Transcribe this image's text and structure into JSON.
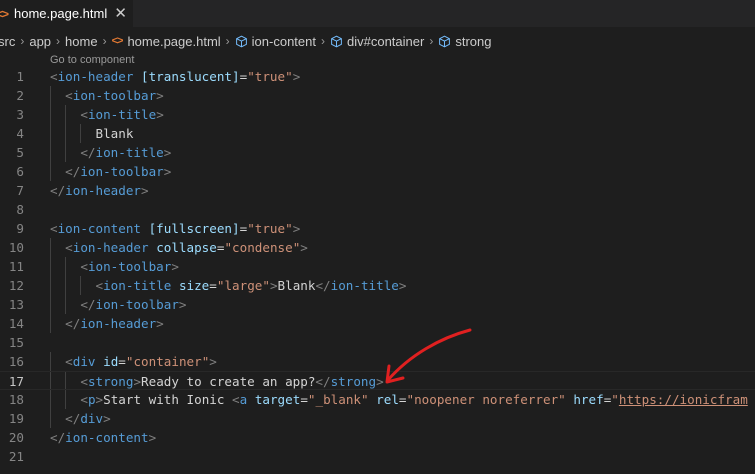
{
  "tab": {
    "icon": "html-file-icon",
    "icon_glyph": "<>",
    "title": "home.page.html",
    "close_glyph": "✕"
  },
  "breadcrumb": {
    "items": [
      {
        "label": "src"
      },
      {
        "label": "app"
      },
      {
        "label": "home"
      },
      {
        "label": "home.page.html",
        "icon": "html-file-icon",
        "icon_glyph": "<>"
      },
      {
        "label": "ion-content",
        "icon": "element-cube-icon"
      },
      {
        "label": "div#container",
        "icon": "element-cube-icon"
      },
      {
        "label": "strong",
        "icon": "element-cube-icon"
      }
    ],
    "separator": "›"
  },
  "codelens": "Go to component",
  "active_line": 17,
  "lines": [
    {
      "n": "1",
      "tokens": [
        [
          "p",
          "<"
        ],
        [
          "t",
          "ion-header"
        ],
        [
          "x",
          " "
        ],
        [
          "a",
          "[translucent]"
        ],
        [
          "x",
          "="
        ],
        [
          "s",
          "\"true\""
        ],
        [
          "p",
          ">"
        ]
      ]
    },
    {
      "n": "2",
      "tokens": [
        [
          "x",
          "  "
        ],
        [
          "p",
          "<"
        ],
        [
          "t",
          "ion-toolbar"
        ],
        [
          "p",
          ">"
        ]
      ]
    },
    {
      "n": "3",
      "tokens": [
        [
          "x",
          "    "
        ],
        [
          "p",
          "<"
        ],
        [
          "t",
          "ion-title"
        ],
        [
          "p",
          ">"
        ]
      ]
    },
    {
      "n": "4",
      "tokens": [
        [
          "x",
          "      Blank"
        ]
      ]
    },
    {
      "n": "5",
      "tokens": [
        [
          "x",
          "    "
        ],
        [
          "p",
          "</"
        ],
        [
          "t",
          "ion-title"
        ],
        [
          "p",
          ">"
        ]
      ]
    },
    {
      "n": "6",
      "tokens": [
        [
          "x",
          "  "
        ],
        [
          "p",
          "</"
        ],
        [
          "t",
          "ion-toolbar"
        ],
        [
          "p",
          ">"
        ]
      ]
    },
    {
      "n": "7",
      "tokens": [
        [
          "p",
          "</"
        ],
        [
          "t",
          "ion-header"
        ],
        [
          "p",
          ">"
        ]
      ]
    },
    {
      "n": "8",
      "tokens": []
    },
    {
      "n": "9",
      "tokens": [
        [
          "p",
          "<"
        ],
        [
          "t",
          "ion-content"
        ],
        [
          "x",
          " "
        ],
        [
          "a",
          "[fullscreen]"
        ],
        [
          "x",
          "="
        ],
        [
          "s",
          "\"true\""
        ],
        [
          "p",
          ">"
        ]
      ]
    },
    {
      "n": "10",
      "tokens": [
        [
          "x",
          "  "
        ],
        [
          "p",
          "<"
        ],
        [
          "t",
          "ion-header"
        ],
        [
          "x",
          " "
        ],
        [
          "a",
          "collapse"
        ],
        [
          "x",
          "="
        ],
        [
          "s",
          "\"condense\""
        ],
        [
          "p",
          ">"
        ]
      ]
    },
    {
      "n": "11",
      "tokens": [
        [
          "x",
          "    "
        ],
        [
          "p",
          "<"
        ],
        [
          "t",
          "ion-toolbar"
        ],
        [
          "p",
          ">"
        ]
      ]
    },
    {
      "n": "12",
      "tokens": [
        [
          "x",
          "      "
        ],
        [
          "p",
          "<"
        ],
        [
          "t",
          "ion-title"
        ],
        [
          "x",
          " "
        ],
        [
          "a",
          "size"
        ],
        [
          "x",
          "="
        ],
        [
          "s",
          "\"large\""
        ],
        [
          "p",
          ">"
        ],
        [
          "x",
          "Blank"
        ],
        [
          "p",
          "</"
        ],
        [
          "t",
          "ion-title"
        ],
        [
          "p",
          ">"
        ]
      ]
    },
    {
      "n": "13",
      "tokens": [
        [
          "x",
          "    "
        ],
        [
          "p",
          "</"
        ],
        [
          "t",
          "ion-toolbar"
        ],
        [
          "p",
          ">"
        ]
      ]
    },
    {
      "n": "14",
      "tokens": [
        [
          "x",
          "  "
        ],
        [
          "p",
          "</"
        ],
        [
          "t",
          "ion-header"
        ],
        [
          "p",
          ">"
        ]
      ]
    },
    {
      "n": "15",
      "tokens": []
    },
    {
      "n": "16",
      "tokens": [
        [
          "x",
          "  "
        ],
        [
          "p",
          "<"
        ],
        [
          "t",
          "div"
        ],
        [
          "x",
          " "
        ],
        [
          "a",
          "id"
        ],
        [
          "x",
          "="
        ],
        [
          "s",
          "\"container\""
        ],
        [
          "p",
          ">"
        ]
      ]
    },
    {
      "n": "17",
      "tokens": [
        [
          "x",
          "    "
        ],
        [
          "p",
          "<"
        ],
        [
          "t",
          "strong"
        ],
        [
          "p",
          ">"
        ],
        [
          "x",
          "Ready to create an app?"
        ],
        [
          "p",
          "</"
        ],
        [
          "t",
          "strong"
        ],
        [
          "p",
          ">"
        ]
      ]
    },
    {
      "n": "18",
      "tokens": [
        [
          "x",
          "    "
        ],
        [
          "p",
          "<"
        ],
        [
          "t",
          "p"
        ],
        [
          "p",
          ">"
        ],
        [
          "x",
          "Start with Ionic "
        ],
        [
          "p",
          "<"
        ],
        [
          "t",
          "a"
        ],
        [
          "x",
          " "
        ],
        [
          "a",
          "target"
        ],
        [
          "x",
          "="
        ],
        [
          "s",
          "\"_blank\""
        ],
        [
          "x",
          " "
        ],
        [
          "a",
          "rel"
        ],
        [
          "x",
          "="
        ],
        [
          "s",
          "\"noopener noreferrer\""
        ],
        [
          "x",
          " "
        ],
        [
          "a",
          "href"
        ],
        [
          "x",
          "="
        ],
        [
          "s",
          "\""
        ],
        [
          "su",
          "https://ionicfram"
        ]
      ]
    },
    {
      "n": "19",
      "tokens": [
        [
          "x",
          "  "
        ],
        [
          "p",
          "</"
        ],
        [
          "t",
          "div"
        ],
        [
          "p",
          ">"
        ]
      ]
    },
    {
      "n": "20",
      "tokens": [
        [
          "p",
          "</"
        ],
        [
          "t",
          "ion-content"
        ],
        [
          "p",
          ">"
        ]
      ]
    },
    {
      "n": "21",
      "tokens": []
    }
  ],
  "colors": {
    "background": "#1e1e1e",
    "tag": "#569cd6",
    "attribute": "#9cdcfe",
    "string": "#ce9178",
    "punctuation": "#808080",
    "annotation_arrow": "#e02020"
  }
}
